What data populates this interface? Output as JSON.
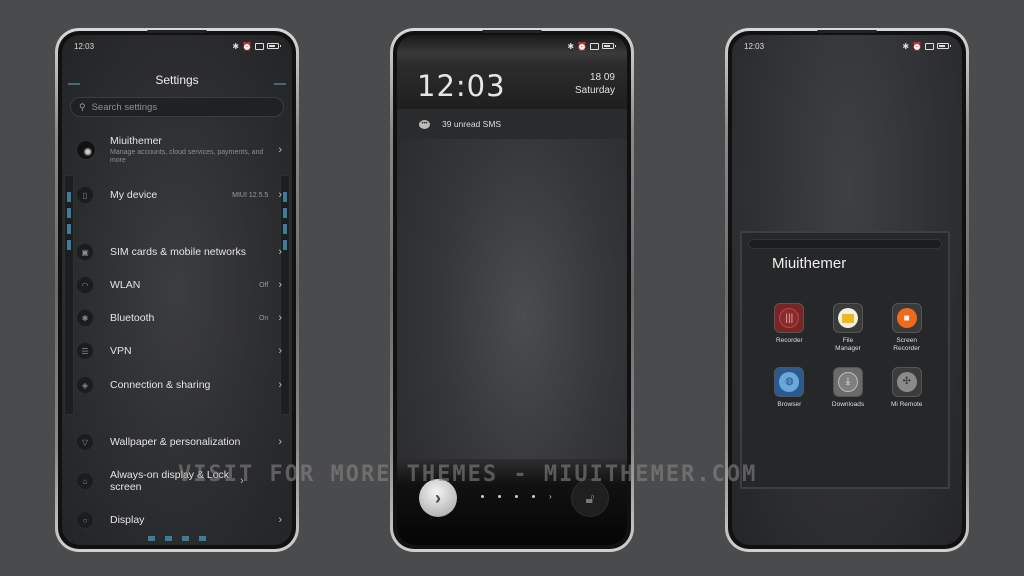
{
  "status": {
    "time": "12:03"
  },
  "settings": {
    "title": "Settings",
    "search_placeholder": "Search settings",
    "account": {
      "name": "Miuithemer",
      "subtitle": "Manage accounts, cloud services, payments, and more"
    },
    "items": [
      {
        "label": "My device",
        "value": "MIUI 12.5.5",
        "icon": "phone-icon"
      },
      {
        "label": "SIM cards & mobile networks",
        "value": "",
        "icon": "sim-icon"
      },
      {
        "label": "WLAN",
        "value": "Off",
        "icon": "wifi-icon"
      },
      {
        "label": "Bluetooth",
        "value": "On",
        "icon": "bluetooth-icon"
      },
      {
        "label": "VPN",
        "value": "",
        "icon": "vpn-icon"
      },
      {
        "label": "Connection & sharing",
        "value": "",
        "icon": "share-icon"
      },
      {
        "label": "Wallpaper & personalization",
        "value": "",
        "icon": "wallpaper-icon"
      },
      {
        "label": "Always-on display & Lock screen",
        "value": "",
        "icon": "lock-icon"
      },
      {
        "label": "Display",
        "value": "",
        "icon": "display-icon"
      }
    ]
  },
  "lockscreen": {
    "time": "12:03",
    "date": "18 09",
    "day": "Saturday",
    "notification": "39 unread SMS"
  },
  "folder": {
    "title": "Miuithemer",
    "apps": [
      {
        "label": "Recorder",
        "color": "#8b2a2a"
      },
      {
        "label": "File Manager",
        "color": "#f2b619"
      },
      {
        "label": "Screen Recorder",
        "color": "#f06a1e"
      },
      {
        "label": "Browser",
        "color": "#2e6aa8"
      },
      {
        "label": "Downloads",
        "color": "#8a8a8a"
      },
      {
        "label": "Mi Remote",
        "color": "#6a6a6a"
      }
    ]
  },
  "watermark": "VISIT FOR MORE THEMES - MIUITHEMER.COM"
}
